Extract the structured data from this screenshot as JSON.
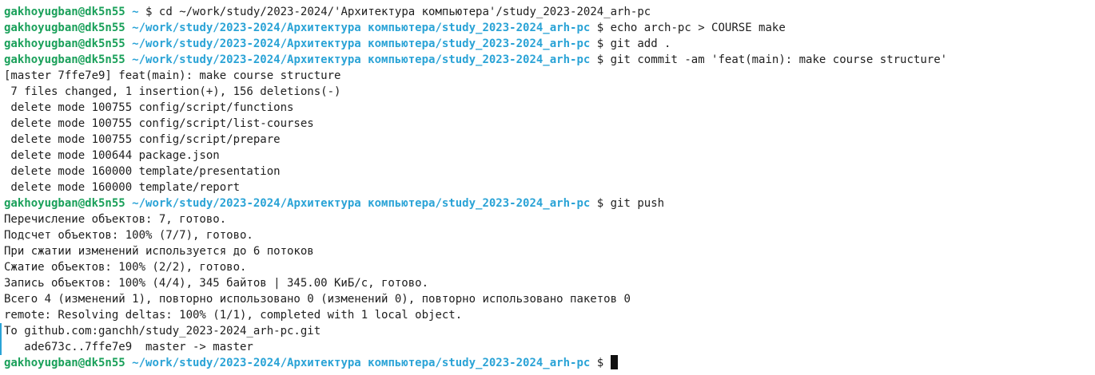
{
  "prompt": {
    "user_host": "gakhoyugban@dk5n55",
    "home_path": "~",
    "repo_path": "~/work/study/2023-2024/Архитектура компьютера/study_2023-2024_arh-pc",
    "dollar": "$"
  },
  "commands": [
    "cd ~/work/study/2023-2024/'Архитектура компьютера'/study_2023-2024_arh-pc",
    "echo arch-pc > COURSE make",
    "git add .",
    "git commit -am 'feat(main): make course structure'",
    "git push"
  ],
  "commit_output": [
    "[master 7ffe7e9] feat(main): make course structure",
    " 7 files changed, 1 insertion(+), 156 deletions(-)",
    " delete mode 100755 config/script/functions",
    " delete mode 100755 config/script/list-courses",
    " delete mode 100755 config/script/prepare",
    " delete mode 100644 package.json",
    " delete mode 160000 template/presentation",
    " delete mode 160000 template/report"
  ],
  "push_output": [
    "Перечисление объектов: 7, готово.",
    "Подсчет объектов: 100% (7/7), готово.",
    "При сжатии изменений используется до 6 потоков",
    "Сжатие объектов: 100% (2/2), готово.",
    "Запись объектов: 100% (4/4), 345 байтов | 345.00 КиБ/с, готово.",
    "Всего 4 (изменений 1), повторно использовано 0 (изменений 0), повторно использовано пакетов 0",
    "remote: Resolving deltas: 100% (1/1), completed with 1 local object.",
    "To github.com:ganchh/study_2023-2024_arh-pc.git",
    "   ade673c..7ffe7e9  master -> master"
  ],
  "colors": {
    "background": "#ffffff",
    "user_host": "#1aa05a",
    "path": "#2aa3d6",
    "text": "#202020"
  }
}
